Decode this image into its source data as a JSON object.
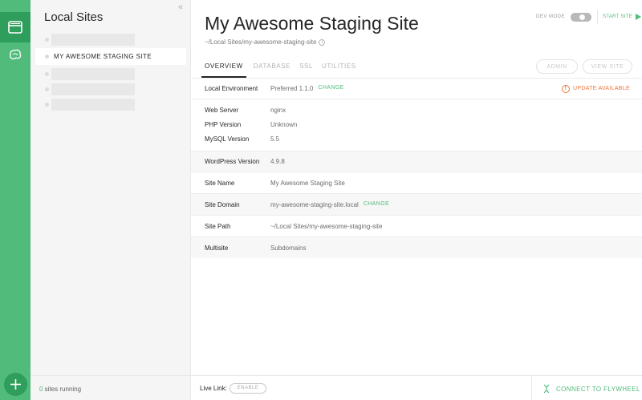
{
  "sidebar": {
    "title": "Local Sites",
    "collapse_glyph": "«",
    "selected_site": "MY AWESOME STAGING SITE",
    "running_count": "0",
    "running_label": " sites running",
    "icons": [
      "sites-icon",
      "flywheel-icon",
      "add-icon"
    ]
  },
  "site": {
    "title": "My Awesome Staging Site",
    "path": "~/Local Sites/my-awesome-staging-site"
  },
  "header": {
    "dev_mode": "DEV MODE",
    "start_site": "START SITE"
  },
  "tabs": [
    "OVERVIEW",
    "DATABASE",
    "SSL",
    "UTILITIES"
  ],
  "buttons": {
    "admin": "ADMIN",
    "view_site": "VIEW SITE"
  },
  "details": {
    "local_env": {
      "label": "Local Environment",
      "value": "Preferred 1.1.0",
      "change": "CHANGE",
      "update": "UPDATE AVAILABLE"
    },
    "web_server": {
      "label": "Web Server",
      "value": "nginx"
    },
    "php": {
      "label": "PHP Version",
      "value": "Unknown"
    },
    "mysql": {
      "label": "MySQL Version",
      "value": "5.5"
    },
    "wordpress": {
      "label": "WordPress Version",
      "value": "4.9.8"
    },
    "site_name": {
      "label": "Site Name",
      "value": "My Awesome Staging Site"
    },
    "site_domain": {
      "label": "Site Domain",
      "value": "my-awesome-staging-site.local",
      "change": "CHANGE"
    },
    "site_path": {
      "label": "Site Path",
      "value": "~/Local Sites/my-awesome-staging-site"
    },
    "multisite": {
      "label": "Multisite",
      "value": "Subdomains"
    }
  },
  "footer": {
    "live_link": "Live Link:",
    "enable": "ENABLE",
    "connect": "CONNECT TO FLYWHEEL"
  },
  "colors": {
    "accent": "#51bb7b",
    "accent_dark": "#2f9d5b",
    "warning": "#f0763a"
  }
}
